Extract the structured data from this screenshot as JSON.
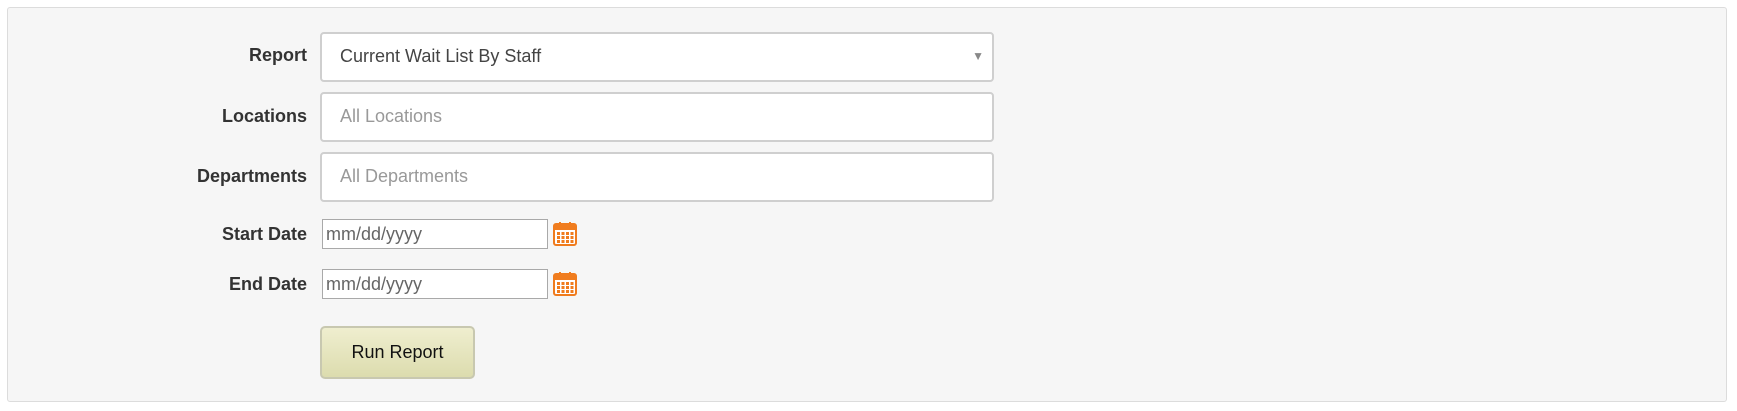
{
  "form": {
    "report": {
      "label": "Report",
      "selected": "Current Wait List By Staff"
    },
    "locations": {
      "label": "Locations",
      "placeholder": "All Locations"
    },
    "departments": {
      "label": "Departments",
      "placeholder": "All Departments"
    },
    "start_date": {
      "label": "Start Date",
      "placeholder": "mm/dd/yyyy"
    },
    "end_date": {
      "label": "End Date",
      "placeholder": "mm/dd/yyyy"
    },
    "run_button": "Run Report"
  },
  "icons": {
    "calendar": "calendar-icon",
    "dropdown": "chevron-down-icon"
  },
  "colors": {
    "calendar_accent": "#f07c1e",
    "button_bg": "#e4e3bd",
    "panel_bg": "#f6f6f6"
  }
}
